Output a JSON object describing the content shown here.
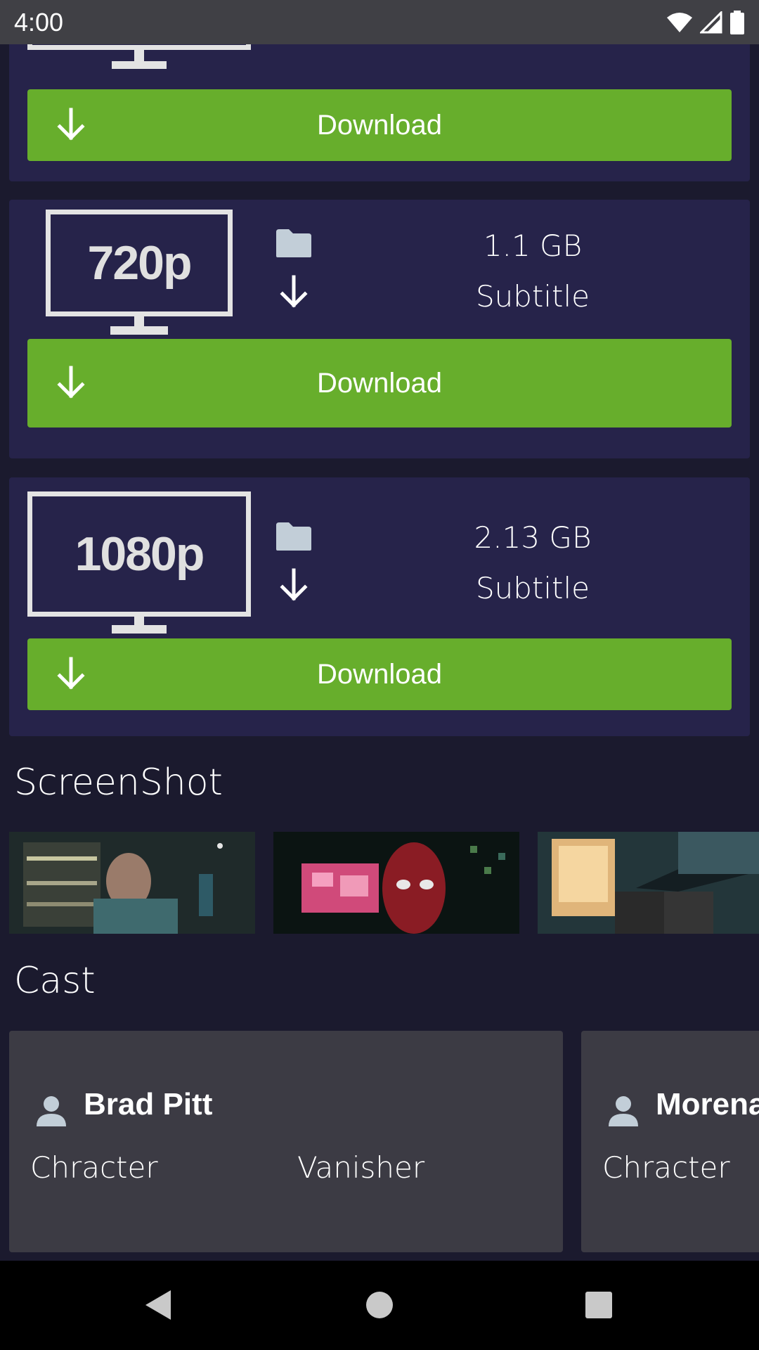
{
  "status_bar": {
    "time": "4:00"
  },
  "qualities": [
    {
      "label": "720p",
      "size": "1.1 GB",
      "subtitle": "Subtitle",
      "button": "Download"
    },
    {
      "label": "1080p",
      "size": "2.13 GB",
      "subtitle": "Subtitle",
      "button": "Download"
    }
  ],
  "top_partial": {
    "button": "Download"
  },
  "sections": {
    "screenshots_title": "ScreenShot",
    "cast_title": "Cast"
  },
  "cast": [
    {
      "name": "Brad Pitt",
      "role_label": "Chracter",
      "role_value": "Vanisher"
    },
    {
      "name": "Morena Baccarin",
      "role_label": "Chracter",
      "role_value": ""
    }
  ],
  "colors": {
    "background": "#1b1a2e",
    "card": "#26234a",
    "accent_green": "#67ae2c",
    "cast_card": "#3c3b44",
    "status_bar": "#404045"
  },
  "icons": {
    "folder": "folder-icon",
    "download": "download-arrow-icon",
    "person": "person-icon"
  }
}
